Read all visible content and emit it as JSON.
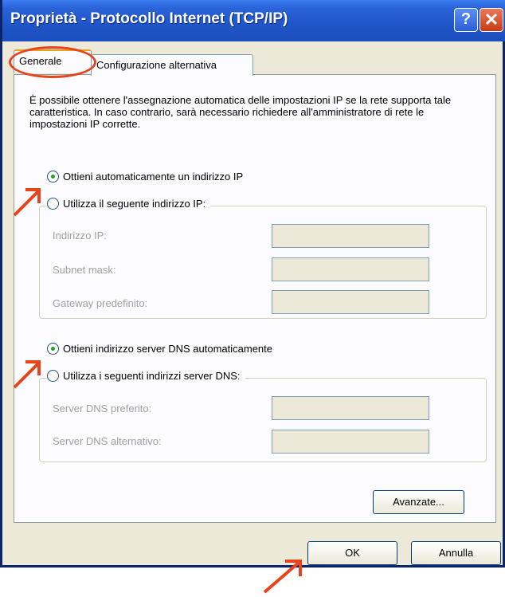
{
  "window": {
    "title": "Proprietà - Protocollo Internet (TCP/IP)",
    "help_label": "?",
    "close_label": "✕"
  },
  "tabs": [
    {
      "label": "Generale"
    },
    {
      "label": "Configurazione alternativa"
    }
  ],
  "description": "È possibile ottenere l'assegnazione automatica delle impostazioni IP se la rete supporta tale caratteristica. In caso contrario, sarà necessario richiedere all'amministratore di rete le impostazioni IP corrette.",
  "ip": {
    "auto_label": "Ottieni automaticamente un indirizzo IP",
    "manual_label": "Utilizza il seguente indirizzo IP:",
    "fields": [
      {
        "label": "Indirizzo IP:",
        "value": ""
      },
      {
        "label": "Subnet mask:",
        "value": ""
      },
      {
        "label": "Gateway predefinito:",
        "value": ""
      }
    ]
  },
  "dns": {
    "auto_label": "Ottieni indirizzo server DNS automaticamente",
    "manual_label": "Utilizza i seguenti indirizzi server DNS:",
    "fields": [
      {
        "label": "Server DNS preferito:",
        "value": ""
      },
      {
        "label": "Server DNS alternativo:",
        "value": ""
      }
    ]
  },
  "buttons": {
    "advanced": "Avanzate...",
    "ok": "OK",
    "cancel": "Annulla"
  },
  "colors": {
    "annotation": "#e8431b",
    "title_bar": "#1f55c8"
  }
}
